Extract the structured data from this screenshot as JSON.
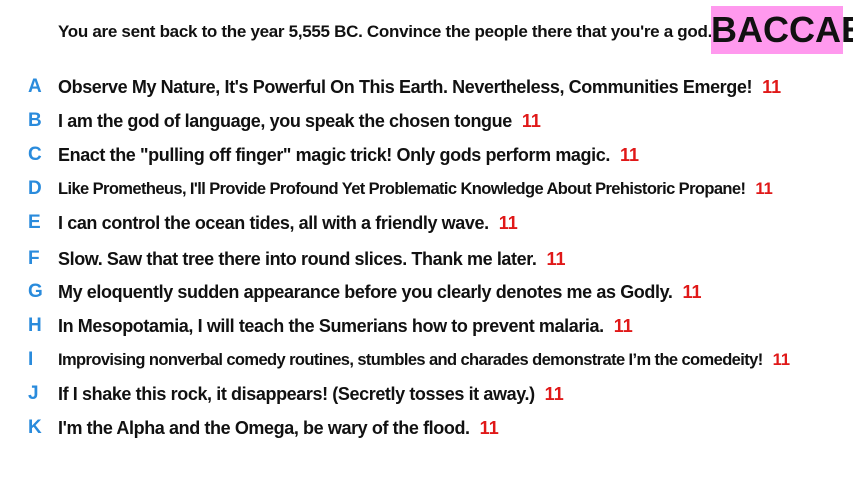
{
  "header": {
    "prompt": "You are sent back to the year 5,555 BC. Convince the people there that you're a god.",
    "badge": "BACCAE"
  },
  "colors": {
    "letter": "#2a8bdc",
    "score": "#e01818",
    "badge_bg": "#ff99ee",
    "text": "#111111"
  },
  "answers": [
    {
      "letter": "A",
      "text": "Observe My Nature, It's Powerful On This Earth. Nevertheless, Communities Emerge!",
      "score": "11"
    },
    {
      "letter": "B",
      "text": "I am the god of language, you speak the chosen tongue",
      "score": "11"
    },
    {
      "letter": "C",
      "text": "Enact the \"pulling off finger\" magic trick! Only gods perform magic.",
      "score": "11"
    },
    {
      "letter": "D",
      "text": "Like Prometheus, I'll Provide Profound Yet Problematic Knowledge About Prehistoric Propane!",
      "score": "11"
    },
    {
      "letter": "E",
      "text": "I can control the ocean tides, all with a friendly wave.",
      "score": "11"
    },
    {
      "letter": "F",
      "text": "Slow. Saw that tree there into round slices. Thank me later.",
      "score": "11"
    },
    {
      "letter": "G",
      "text": "My eloquently sudden appearance before you clearly denotes me as Godly.",
      "score": "11"
    },
    {
      "letter": "H",
      "text": "In Mesopotamia, I will teach the Sumerians how to prevent malaria.",
      "score": "11"
    },
    {
      "letter": "I",
      "text": "Improvising nonverbal comedy routines, stumbles and charades demonstrate I’m the comedeity!",
      "score": "11"
    },
    {
      "letter": "J",
      "text": "If I shake this rock, it disappears! (Secretly tosses it away.)",
      "score": "11"
    },
    {
      "letter": "K",
      "text": "I'm the Alpha and the Omega, be wary of the flood.",
      "score": "11"
    }
  ]
}
